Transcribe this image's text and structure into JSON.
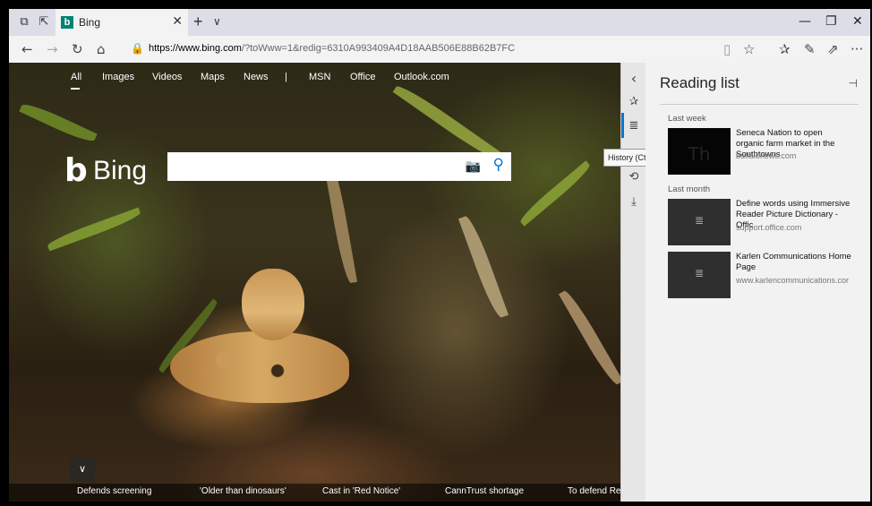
{
  "tabbar": {
    "tab_title": "Bing",
    "tab_favicon": "b",
    "close_glyph": "✕",
    "new_tab_glyph": "+",
    "tab_menu_glyph": "∨",
    "set_aside_glyph": "⧉",
    "tabs_aside_glyph": "⇱",
    "minimize_glyph": "—",
    "restore_glyph": "❐",
    "close_window_glyph": "✕"
  },
  "navbar": {
    "back_glyph": "←",
    "forward_glyph": "→",
    "refresh_glyph": "↻",
    "home_glyph": "⌂",
    "lock_glyph": "🔒",
    "url_host": "https://www.bing.com",
    "url_rest": "/?toWww=1&redig=6310A993409A4D18AAB506E88B62B7FC",
    "reading_view_glyph": "▯",
    "favorite_glyph": "☆",
    "favorites_hub_glyph": "✰",
    "notes_glyph": "✎",
    "share_glyph": "⇗",
    "more_glyph": "···"
  },
  "page": {
    "nav": [
      "All",
      "Images",
      "Videos",
      "Maps",
      "News",
      "|",
      "MSN",
      "Office",
      "Outlook.com"
    ],
    "logo_b": "b",
    "logo_word": "Bing",
    "search_placeholder": "",
    "camera_glyph": "📷",
    "search_glyph": "⚲",
    "scroll_glyph": "∨",
    "news": [
      "Defends screening",
      "'Older than dinosaurs'",
      "Cast in 'Red Notice'",
      "CannTrust shortage",
      "To defend Res"
    ]
  },
  "hub": {
    "collapse_glyph": "‹",
    "favorites_glyph": "✰",
    "reading_list_glyph": "≣",
    "history_glyph": "⟲",
    "downloads_glyph": "⤓",
    "tooltip": "History (Ctrl+H)"
  },
  "reading_list": {
    "title": "Reading list",
    "pin_glyph": "⊣",
    "groups": [
      {
        "label": "Last week",
        "items": [
          {
            "title": "Seneca Nation to open organic farm market in the Southtowns",
            "source": "buffalonews.com",
            "thumb_glyph": "Th"
          }
        ]
      },
      {
        "label": "Last month",
        "items": [
          {
            "title": "Define words using Immersive Reader Picture Dictionary - Offic",
            "source": "support.office.com",
            "thumb_glyph": "≣"
          },
          {
            "title": "Karlen Communications Home Page",
            "source": "www.karlencommunications.cor",
            "thumb_glyph": "≣"
          }
        ]
      }
    ]
  },
  "colors": {
    "accent": "#0078d4",
    "bing_teal": "#008373",
    "panel_bg": "#f2f2f2"
  }
}
